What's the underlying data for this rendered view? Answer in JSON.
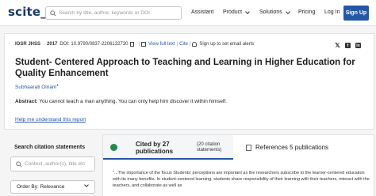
{
  "header": {
    "logo": "scite_",
    "search_placeholder": "Search by title, author, keywords or DOI",
    "nav": {
      "assistant": "Assistant",
      "product": "Product",
      "solutions": "Solutions",
      "pricing": "Pricing",
      "login": "Log In",
      "signup": "Sign Up"
    }
  },
  "article": {
    "journal": "IOSR JHSS",
    "year": "2017",
    "doi": "DOI: 10.9790/0837-2206132730",
    "view_full_text": "View full text",
    "cite": "Cite",
    "alerts": "Sign up to set email alerts",
    "title": "Student- Centered Approach to Teaching and Learning in Higher Education for Quality Enhancement",
    "author": "Subhaarati Oinam",
    "author_sup": "1",
    "abstract_label": "Abstract:",
    "abstract_text": "You cannot teach a man anything. You can only help him discover it within himself.",
    "help_link": "Help me understand this report"
  },
  "sidebar": {
    "title": "Search citation statements",
    "search_placeholder": "Context, author(s), title etc",
    "order_by": "Order By: Relevance"
  },
  "tabs": {
    "cited_label": "Cited by 27 publications",
    "cited_line1": "Cited by 27",
    "cited_line2": "publications",
    "citation_statements_line1": "(20 citation",
    "citation_statements_line2": "statements)",
    "references": "References 5 publications"
  },
  "excerpt": "\"...The importance of the focus Students' perceptions are important as the researchers subscribe to the learner-centered education with its many benefits. In student-centered learning, students share responsibility of their learning with their teachers, interact with the teachers, and collaborate as well as",
  "colors": {
    "brand_blue": "#2557a7",
    "logo_navy": "#1a3a6e",
    "cited_green": "#1f8a4c"
  }
}
